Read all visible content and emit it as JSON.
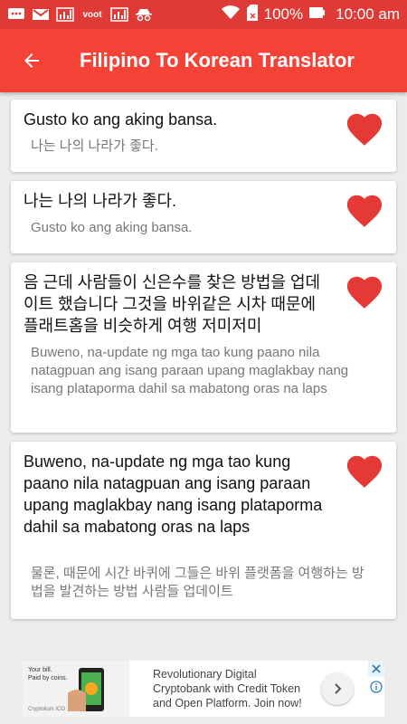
{
  "status_bar": {
    "battery": "100%",
    "time": "10:00 am",
    "left_icons": [
      "chat-icon",
      "gmail-icon",
      "chart-icon",
      "voot-icon",
      "chart-icon",
      "incognito-icon"
    ],
    "voot_label": "voot"
  },
  "app_bar": {
    "title": "Filipino To Korean Translator",
    "back_icon": "arrow-left-icon",
    "color": "#f44336"
  },
  "translations": [
    {
      "source": "Gusto ko ang aking bansa.",
      "result": "나는 나의 나라가 좋다."
    },
    {
      "source": "나는 나의 나라가 좋다.",
      "result": "Gusto ko ang aking bansa."
    },
    {
      "source": "음 근데 사람들이 신은수를 찾은 방법을 업데이트 했습니다 그것을 바위같은 시차 때문에 플래트홈을 비슷하게 여행 저미저미",
      "result": "Buweno, na-update ng mga tao kung paano nila natagpuan ang isang paraan upang maglakbay nang isang plataporma dahil sa mabatong oras na laps"
    },
    {
      "source": "Buweno, na-update ng mga tao kung paano nila natagpuan ang isang paraan upang maglakbay nang isang plataporma dahil sa mabatong oras na laps",
      "result": "물론, 때문에 시간 바퀴에 그들은 바위 플랫폼을 여행하는 방법을 발견하는 방법 사람들 업데이트"
    }
  ],
  "heart_color": "#e53935",
  "ad": {
    "text": "Revolutionary Digital Cryptobank with Credit Token and Open Platform. Join now!",
    "img_line1": "Your bill.",
    "img_line2": "Paid by coins.",
    "img_brand": "Cryptolium ICO"
  }
}
